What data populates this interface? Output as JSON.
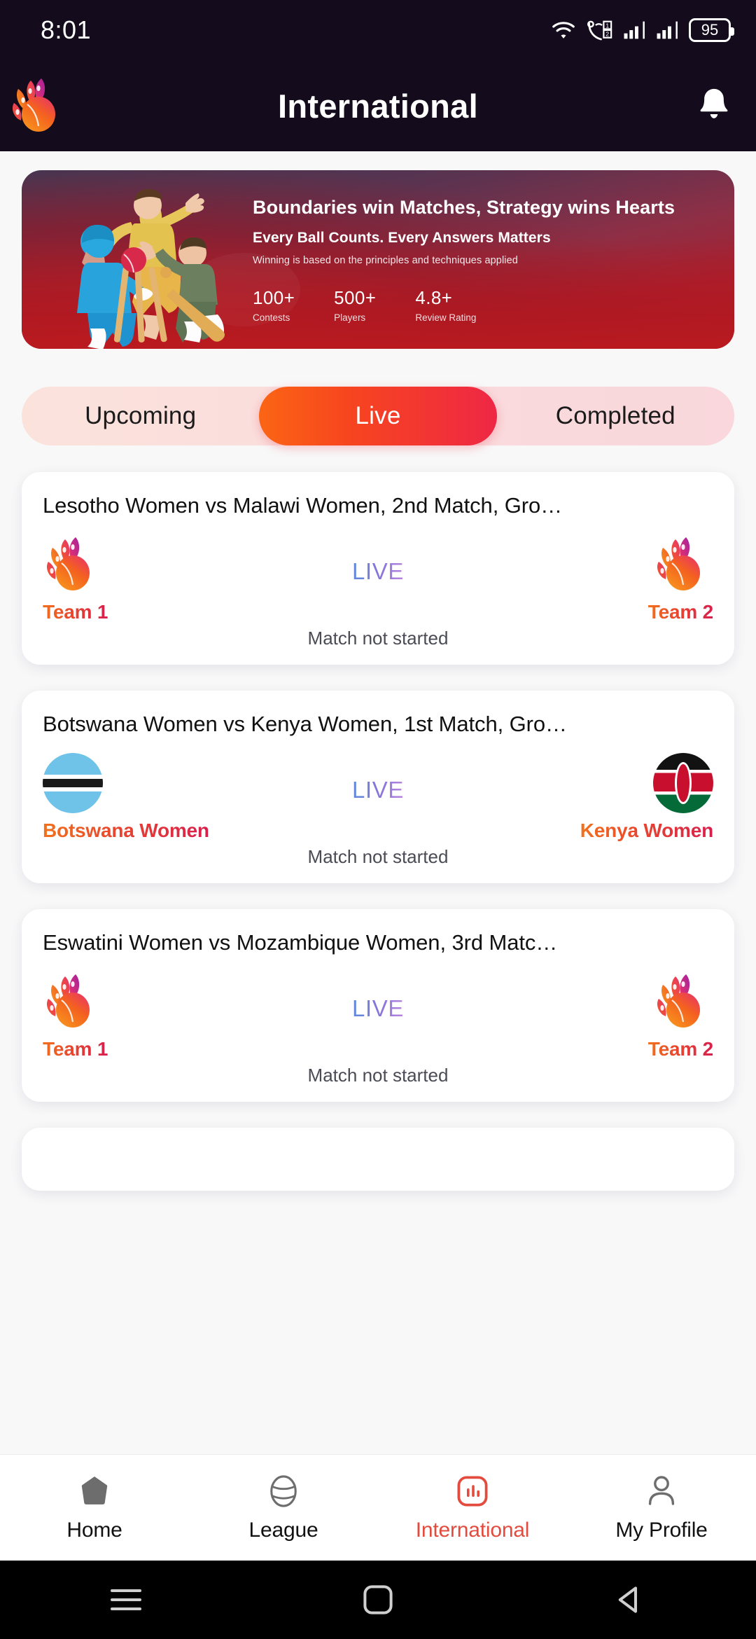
{
  "status_bar": {
    "time": "8:01",
    "battery": "95",
    "icons": [
      "wifi-icon",
      "call-sim-icon",
      "signal-sim1-icon",
      "signal-sim2-icon",
      "battery-icon"
    ]
  },
  "header": {
    "title": "International",
    "logo": "app-logo-flame-ball",
    "notification_icon": "bell-icon"
  },
  "banner": {
    "headline": "Boundaries win Matches, Strategy wins Hearts",
    "subheadline": "Every Ball Counts. Every Answers Matters",
    "description": "Winning is based on the principles and techniques applied",
    "stats": [
      {
        "value": "100+",
        "label": "Contests"
      },
      {
        "value": "500+",
        "label": "Players"
      },
      {
        "value": "4.8+",
        "label": "Review Rating"
      }
    ]
  },
  "tabs": {
    "items": [
      {
        "label": "Upcoming",
        "active": false
      },
      {
        "label": "Live",
        "active": true
      },
      {
        "label": "Completed",
        "active": false
      }
    ]
  },
  "matches": [
    {
      "title": "Lesotho Women vs Malawi Women, 2nd Match, Gro…",
      "team1": {
        "name": "Team 1",
        "badge": "app-logo-placeholder"
      },
      "team2": {
        "name": "Team 2",
        "badge": "app-logo-placeholder"
      },
      "live_label": "LIVE",
      "status": "Match not started"
    },
    {
      "title": "Botswana Women vs Kenya Women, 1st Match, Gro…",
      "team1": {
        "name": "Botswana Women",
        "badge": "flag-botswana"
      },
      "team2": {
        "name": "Kenya Women",
        "badge": "flag-kenya"
      },
      "live_label": "LIVE",
      "status": "Match not started"
    },
    {
      "title": "Eswatini Women vs Mozambique Women, 3rd Matc…",
      "team1": {
        "name": "Team 1",
        "badge": "app-logo-placeholder"
      },
      "team2": {
        "name": "Team 2",
        "badge": "app-logo-placeholder"
      },
      "live_label": "LIVE",
      "status": "Match not started"
    }
  ],
  "bottom_nav": {
    "items": [
      {
        "label": "Home",
        "icon": "home-icon",
        "active": false
      },
      {
        "label": "League",
        "icon": "ball-icon",
        "active": false
      },
      {
        "label": "International",
        "icon": "bar-chart-icon",
        "active": true
      },
      {
        "label": "My Profile",
        "icon": "person-icon",
        "active": false
      }
    ]
  },
  "system_nav": {
    "items": [
      "menu-icon",
      "home-square-icon",
      "back-icon"
    ]
  },
  "colors": {
    "header_bg": "#140c1c",
    "accent_orange": "#fb6514",
    "accent_red": "#ee2745",
    "live_blue": "#5b8ade",
    "live_purple": "#b887dd",
    "nav_active": "#e24b3e"
  }
}
